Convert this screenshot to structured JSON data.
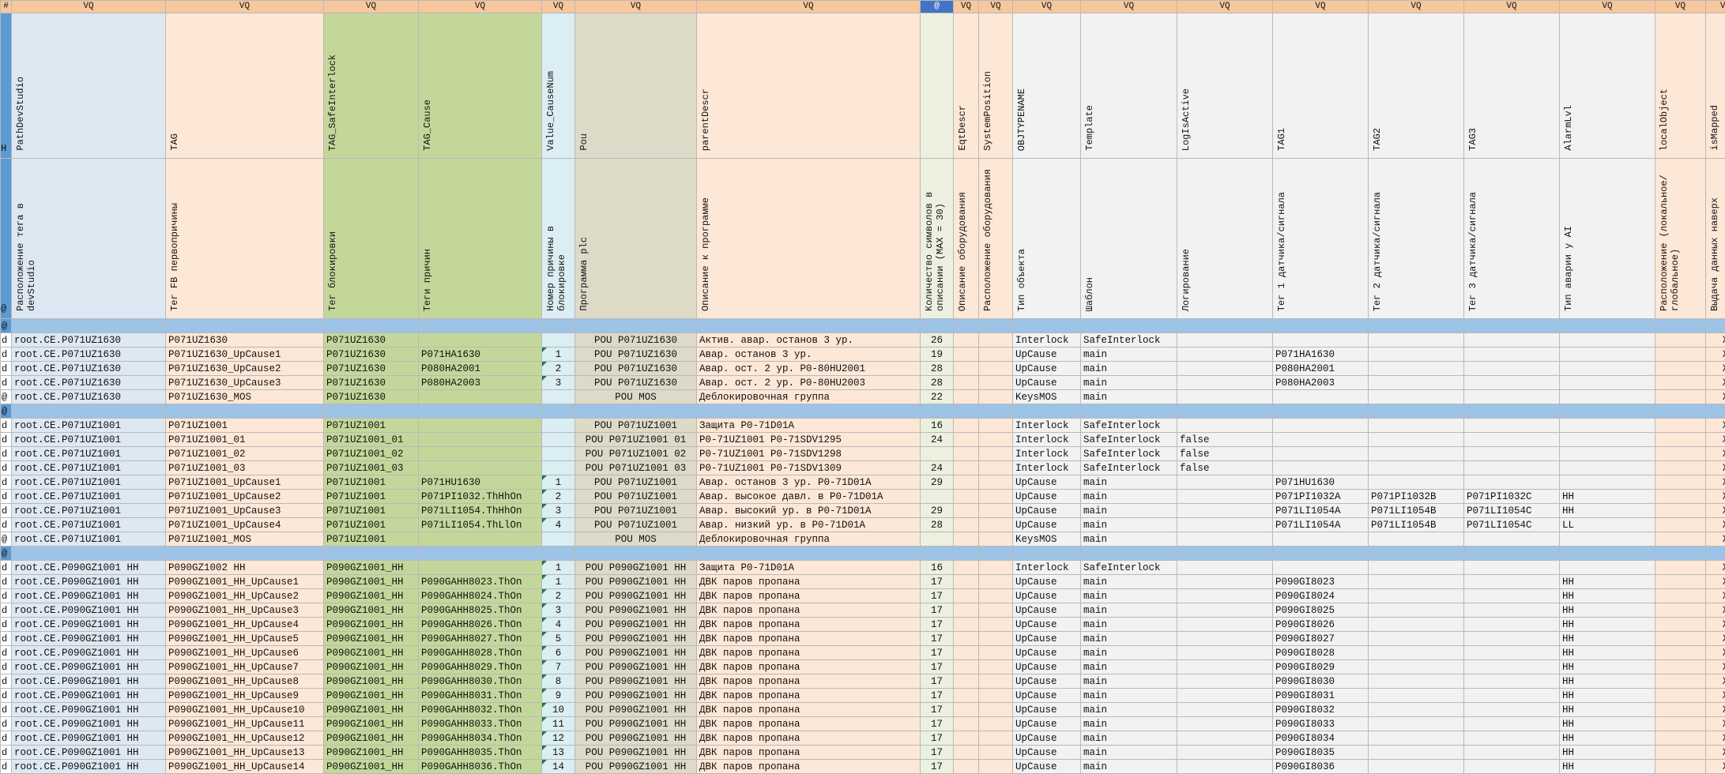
{
  "colors": {
    "vq_header": "#f7c79d",
    "path": "#dde8f2",
    "tag": "#fde7d6",
    "interlock": "#c4d79b",
    "separator": "#9dc3e6",
    "marker": "#5b9bd5"
  },
  "columns": [
    {
      "key": "path",
      "vq": "VQ",
      "name": "PathDevStudio",
      "desc": "Расположение тега в devStudio",
      "cls": "pb",
      "w": 195
    },
    {
      "key": "tag",
      "vq": "VQ",
      "name": "TAG",
      "desc": "Тег FB первопричины",
      "cls": "pe",
      "w": 200
    },
    {
      "key": "tag_safe",
      "vq": "VQ",
      "name": "TAG_SafeInterlock",
      "desc": "Тег блокировки",
      "cls": "gr",
      "w": 120
    },
    {
      "key": "tag_cause",
      "vq": "VQ",
      "name": "TAG_Cause",
      "desc": "Теги причин",
      "cls": "gr",
      "w": 156
    },
    {
      "key": "cause_num",
      "vq": "VQ",
      "name": "Value_CauseNum",
      "desc": "Номер причины в блокировке",
      "cls": "bl",
      "w": 42
    },
    {
      "key": "pou",
      "vq": "VQ",
      "name": "Pou",
      "desc": "Программа plc",
      "cls": "ol",
      "w": 154
    },
    {
      "key": "parent_descr",
      "vq": "VQ",
      "name": "parentDescr",
      "desc": "Описание к программе",
      "cls": "pe",
      "w": 283
    },
    {
      "key": "char_count",
      "vq": "@",
      "name": "",
      "desc": "Количество символов в описании (MAX = 30)",
      "cls": "ng",
      "w": 42
    },
    {
      "key": "eqt_descr",
      "vq": "VQ",
      "name": "EqtDescr",
      "desc": "Описание оборудования",
      "cls": "pe",
      "w": 32
    },
    {
      "key": "sys_pos",
      "vq": "VQ",
      "name": "SystemPosition",
      "desc": "Расположение оборудования",
      "cls": "pe",
      "w": 43
    },
    {
      "key": "objtype",
      "vq": "VQ",
      "name": "OBJTYPENAME",
      "desc": "Тип объекта",
      "cls": "gy",
      "w": 86
    },
    {
      "key": "template",
      "vq": "VQ",
      "name": "Template",
      "desc": "Шаблон",
      "cls": "gy",
      "w": 122
    },
    {
      "key": "log_active",
      "vq": "VQ",
      "name": "LogIsActive",
      "desc": "Логирование",
      "cls": "gy",
      "w": 121
    },
    {
      "key": "tag1",
      "vq": "VQ",
      "name": "TAG1",
      "desc": "Тег 1 датчика/сигнала",
      "cls": "gy",
      "w": 121
    },
    {
      "key": "tag2",
      "vq": "VQ",
      "name": "TAG2",
      "desc": "Тег 2 датчика/сигнала",
      "cls": "gy",
      "w": 121
    },
    {
      "key": "tag3",
      "vq": "VQ",
      "name": "TAG3",
      "desc": "Тег 3 датчика/сигнала",
      "cls": "gy",
      "w": 121
    },
    {
      "key": "alarm",
      "vq": "VQ",
      "name": "AlarmLvl",
      "desc": "Тип аварии у AI",
      "cls": "gy",
      "w": 121
    },
    {
      "key": "local_obj",
      "vq": "VQ",
      "name": "localObject",
      "desc": "Расположение (локальное/глобальное)",
      "cls": "pe",
      "w": 64
    },
    {
      "key": "is_mapped",
      "vq": "VQ",
      "name": "isMapped",
      "desc": "Выдача данных наверх",
      "cls": "pe",
      "w": 50
    }
  ],
  "marker_header": {
    "vq": "#",
    "hdr": "H",
    "desc": "@"
  },
  "rows": [
    {
      "type": "sep",
      "mk": "@"
    },
    {
      "mk": "d",
      "path": "root.CE.P071UZ1630",
      "tag": "P071UZ1630",
      "tag_safe": "P071UZ1630",
      "tag_cause": "",
      "cause_num": "",
      "pou": "POU P071UZ1630",
      "parent_descr": "Актив. авар. останов 3 ур.",
      "char_count": "26",
      "eqt_descr": "",
      "sys_pos": "",
      "objtype": "Interlock",
      "template": "SafeInterlock",
      "log_active": "",
      "tag1": "",
      "tag2": "",
      "tag3": "",
      "alarm": "",
      "local_obj": "",
      "is_mapped": "X"
    },
    {
      "mk": "d",
      "path": "root.CE.P071UZ1630",
      "tag": "P071UZ1630_UpCause1",
      "tag_safe": "P071UZ1630",
      "tag_cause": "P071HA1630",
      "cause_num": "1",
      "pou": "POU P071UZ1630",
      "parent_descr": "Авар. останов 3 ур.",
      "char_count": "19",
      "eqt_descr": "",
      "sys_pos": "",
      "objtype": "UpCause",
      "template": "main",
      "log_active": "",
      "tag1": "P071HA1630",
      "tag2": "",
      "tag3": "",
      "alarm": "",
      "local_obj": "",
      "is_mapped": "X"
    },
    {
      "mk": "d",
      "path": "root.CE.P071UZ1630",
      "tag": "P071UZ1630_UpCause2",
      "tag_safe": "P071UZ1630",
      "tag_cause": "P080HA2001",
      "cause_num": "2",
      "pou": "POU P071UZ1630",
      "parent_descr": "Авар. ост. 2 ур. P0-80HU2001",
      "char_count": "28",
      "eqt_descr": "",
      "sys_pos": "",
      "objtype": "UpCause",
      "template": "main",
      "log_active": "",
      "tag1": "P080HA2001",
      "tag2": "",
      "tag3": "",
      "alarm": "",
      "local_obj": "",
      "is_mapped": "X"
    },
    {
      "mk": "d",
      "path": "root.CE.P071UZ1630",
      "tag": "P071UZ1630_UpCause3",
      "tag_safe": "P071UZ1630",
      "tag_cause": "P080HA2003",
      "cause_num": "3",
      "pou": "POU P071UZ1630",
      "parent_descr": "Авар. ост. 2 ур. P0-80HU2003",
      "char_count": "28",
      "eqt_descr": "",
      "sys_pos": "",
      "objtype": "UpCause",
      "template": "main",
      "log_active": "",
      "tag1": "P080HA2003",
      "tag2": "",
      "tag3": "",
      "alarm": "",
      "local_obj": "",
      "is_mapped": "X"
    },
    {
      "mk": "@",
      "path": "root.CE.P071UZ1630",
      "tag": "P071UZ1630_MOS",
      "tag_safe": "P071UZ1630",
      "tag_cause": "",
      "cause_num": "",
      "pou": "POU MOS",
      "parent_descr": "Деблокировочная группа",
      "char_count": "22",
      "eqt_descr": "",
      "sys_pos": "",
      "objtype": "KeysMOS",
      "template": "main",
      "log_active": "",
      "tag1": "",
      "tag2": "",
      "tag3": "",
      "alarm": "",
      "local_obj": "",
      "is_mapped": "X"
    },
    {
      "type": "sep",
      "mk": "@"
    },
    {
      "mk": "d",
      "path": "root.CE.P071UZ1001",
      "tag": "P071UZ1001",
      "tag_safe": "P071UZ1001",
      "tag_cause": "",
      "cause_num": "",
      "pou": "POU P071UZ1001",
      "parent_descr": "Защита P0-71D01A",
      "char_count": "16",
      "eqt_descr": "",
      "sys_pos": "",
      "objtype": "Interlock",
      "template": "SafeInterlock",
      "log_active": "",
      "tag1": "",
      "tag2": "",
      "tag3": "",
      "alarm": "",
      "local_obj": "",
      "is_mapped": "X"
    },
    {
      "mk": "d",
      "path": "root.CE.P071UZ1001",
      "tag": "P071UZ1001_01",
      "tag_safe": "P071UZ1001_01",
      "tag_cause": "",
      "cause_num": "",
      "pou": "POU P071UZ1001 01",
      "parent_descr": "P0-71UZ1001 P0-71SDV1295",
      "char_count": "24",
      "eqt_descr": "",
      "sys_pos": "",
      "objtype": "Interlock",
      "template": "SafeInterlock",
      "log_active": "false",
      "tag1": "",
      "tag2": "",
      "tag3": "",
      "alarm": "",
      "local_obj": "",
      "is_mapped": "X"
    },
    {
      "mk": "d",
      "path": "root.CE.P071UZ1001",
      "tag": "P071UZ1001_02",
      "tag_safe": "P071UZ1001_02",
      "tag_cause": "",
      "cause_num": "",
      "pou": "POU P071UZ1001 02",
      "parent_descr": "P0-71UZ1001 P0-71SDV1298",
      "char_count": "",
      "eqt_descr": "",
      "sys_pos": "",
      "objtype": "Interlock",
      "template": "SafeInterlock",
      "log_active": "false",
      "tag1": "",
      "tag2": "",
      "tag3": "",
      "alarm": "",
      "local_obj": "",
      "is_mapped": "X"
    },
    {
      "mk": "d",
      "path": "root.CE.P071UZ1001",
      "tag": "P071UZ1001_03",
      "tag_safe": "P071UZ1001_03",
      "tag_cause": "",
      "cause_num": "",
      "pou": "POU P071UZ1001 03",
      "parent_descr": "P0-71UZ1001 P0-71SDV1309",
      "char_count": "24",
      "eqt_descr": "",
      "sys_pos": "",
      "objtype": "Interlock",
      "template": "SafeInterlock",
      "log_active": "false",
      "tag1": "",
      "tag2": "",
      "tag3": "",
      "alarm": "",
      "local_obj": "",
      "is_mapped": "X"
    },
    {
      "mk": "d",
      "path": "root.CE.P071UZ1001",
      "tag": "P071UZ1001_UpCause1",
      "tag_safe": "P071UZ1001",
      "tag_cause": "P071HU1630",
      "cause_num": "1",
      "pou": "POU P071UZ1001",
      "parent_descr": "Авар. останов 3 ур. P0-71D01A",
      "char_count": "29",
      "eqt_descr": "",
      "sys_pos": "",
      "objtype": "UpCause",
      "template": "main",
      "log_active": "",
      "tag1": "P071HU1630",
      "tag2": "",
      "tag3": "",
      "alarm": "",
      "local_obj": "",
      "is_mapped": "X"
    },
    {
      "mk": "d",
      "path": "root.CE.P071UZ1001",
      "tag": "P071UZ1001_UpCause2",
      "tag_safe": "P071UZ1001",
      "tag_cause": "P071PI1032.ThHhOn",
      "cause_num": "2",
      "pou": "POU P071UZ1001",
      "parent_descr": "Авар. высокое давл. в P0-71D01A",
      "char_count": "",
      "eqt_descr": "",
      "sys_pos": "",
      "objtype": "UpCause",
      "template": "main",
      "log_active": "",
      "tag1": "P071PI1032A",
      "tag2": "P071PI1032B",
      "tag3": "P071PI1032C",
      "alarm": "HH",
      "local_obj": "",
      "is_mapped": "X"
    },
    {
      "mk": "d",
      "path": "root.CE.P071UZ1001",
      "tag": "P071UZ1001_UpCause3",
      "tag_safe": "P071UZ1001",
      "tag_cause": "P071LI1054.ThHhOn",
      "cause_num": "3",
      "pou": "POU P071UZ1001",
      "parent_descr": "Авар. высокий ур. в P0-71D01A",
      "char_count": "29",
      "eqt_descr": "",
      "sys_pos": "",
      "objtype": "UpCause",
      "template": "main",
      "log_active": "",
      "tag1": "P071LI1054A",
      "tag2": "P071LI1054B",
      "tag3": "P071LI1054C",
      "alarm": "HH",
      "local_obj": "",
      "is_mapped": "X"
    },
    {
      "mk": "d",
      "path": "root.CE.P071UZ1001",
      "tag": "P071UZ1001_UpCause4",
      "tag_safe": "P071UZ1001",
      "tag_cause": "P071LI1054.ThLlOn",
      "cause_num": "4",
      "pou": "POU P071UZ1001",
      "parent_descr": "Авар. низкий ур. в P0-71D01A",
      "char_count": "28",
      "eqt_descr": "",
      "sys_pos": "",
      "objtype": "UpCause",
      "template": "main",
      "log_active": "",
      "tag1": "P071LI1054A",
      "tag2": "P071LI1054B",
      "tag3": "P071LI1054C",
      "alarm": "LL",
      "local_obj": "",
      "is_mapped": "X"
    },
    {
      "mk": "@",
      "path": "root.CE.P071UZ1001",
      "tag": "P071UZ1001_MOS",
      "tag_safe": "P071UZ1001",
      "tag_cause": "",
      "cause_num": "",
      "pou": "POU MOS",
      "parent_descr": "Деблокировочная группа",
      "char_count": "",
      "eqt_descr": "",
      "sys_pos": "",
      "objtype": "KeysMOS",
      "template": "main",
      "log_active": "",
      "tag1": "",
      "tag2": "",
      "tag3": "",
      "alarm": "",
      "local_obj": "",
      "is_mapped": "X"
    },
    {
      "type": "sep",
      "mk": "@"
    },
    {
      "mk": "d",
      "path": "root.CE.P090GZ1001 HH",
      "tag": "P090GZ1002 HH",
      "tag_safe": "P090GZ1001_HH",
      "tag_cause": "",
      "cause_num": "1",
      "pou": "POU P090GZ1001 HH",
      "parent_descr": "Защита P0-71D01A",
      "char_count": "16",
      "eqt_descr": "",
      "sys_pos": "",
      "objtype": "Interlock",
      "template": "SafeInterlock",
      "log_active": "",
      "tag1": "",
      "tag2": "",
      "tag3": "",
      "alarm": "",
      "local_obj": "",
      "is_mapped": "X"
    },
    {
      "mk": "d",
      "path": "root.CE.P090GZ1001 HH",
      "tag": "P090GZ1001_HH_UpCause1",
      "tag_safe": "P090GZ1001_HH",
      "tag_cause": "P090GAHH8023.ThOn",
      "cause_num": "1",
      "pou": "POU P090GZ1001 HH",
      "parent_descr": "ДВК паров пропана",
      "char_count": "17",
      "eqt_descr": "",
      "sys_pos": "",
      "objtype": "UpCause",
      "template": "main",
      "log_active": "",
      "tag1": "P090GI8023",
      "tag2": "",
      "tag3": "",
      "alarm": "HH",
      "local_obj": "",
      "is_mapped": "X"
    },
    {
      "mk": "d",
      "path": "root.CE.P090GZ1001 HH",
      "tag": "P090GZ1001_HH_UpCause2",
      "tag_safe": "P090GZ1001_HH",
      "tag_cause": "P090GAHH8024.ThOn",
      "cause_num": "2",
      "pou": "POU P090GZ1001 HH",
      "parent_descr": "ДВК паров пропана",
      "char_count": "17",
      "eqt_descr": "",
      "sys_pos": "",
      "objtype": "UpCause",
      "template": "main",
      "log_active": "",
      "tag1": "P090GI8024",
      "tag2": "",
      "tag3": "",
      "alarm": "HH",
      "local_obj": "",
      "is_mapped": "X"
    },
    {
      "mk": "d",
      "path": "root.CE.P090GZ1001 HH",
      "tag": "P090GZ1001_HH_UpCause3",
      "tag_safe": "P090GZ1001_HH",
      "tag_cause": "P090GAHH8025.ThOn",
      "cause_num": "3",
      "pou": "POU P090GZ1001 HH",
      "parent_descr": "ДВК паров пропана",
      "char_count": "17",
      "eqt_descr": "",
      "sys_pos": "",
      "objtype": "UpCause",
      "template": "main",
      "log_active": "",
      "tag1": "P090GI8025",
      "tag2": "",
      "tag3": "",
      "alarm": "HH",
      "local_obj": "",
      "is_mapped": "X"
    },
    {
      "mk": "d",
      "path": "root.CE.P090GZ1001 HH",
      "tag": "P090GZ1001_HH_UpCause4",
      "tag_safe": "P090GZ1001_HH",
      "tag_cause": "P090GAHH8026.ThOn",
      "cause_num": "4",
      "pou": "POU P090GZ1001 HH",
      "parent_descr": "ДВК паров пропана",
      "char_count": "17",
      "eqt_descr": "",
      "sys_pos": "",
      "objtype": "UpCause",
      "template": "main",
      "log_active": "",
      "tag1": "P090GI8026",
      "tag2": "",
      "tag3": "",
      "alarm": "HH",
      "local_obj": "",
      "is_mapped": "X"
    },
    {
      "mk": "d",
      "path": "root.CE.P090GZ1001 HH",
      "tag": "P090GZ1001_HH_UpCause5",
      "tag_safe": "P090GZ1001_HH",
      "tag_cause": "P090GAHH8027.ThOn",
      "cause_num": "5",
      "pou": "POU P090GZ1001 HH",
      "parent_descr": "ДВК паров пропана",
      "char_count": "17",
      "eqt_descr": "",
      "sys_pos": "",
      "objtype": "UpCause",
      "template": "main",
      "log_active": "",
      "tag1": "P090GI8027",
      "tag2": "",
      "tag3": "",
      "alarm": "HH",
      "local_obj": "",
      "is_mapped": "X"
    },
    {
      "mk": "d",
      "path": "root.CE.P090GZ1001 HH",
      "tag": "P090GZ1001_HH_UpCause6",
      "tag_safe": "P090GZ1001_HH",
      "tag_cause": "P090GAHH8028.ThOn",
      "cause_num": "6",
      "pou": "POU P090GZ1001 HH",
      "parent_descr": "ДВК паров пропана",
      "char_count": "17",
      "eqt_descr": "",
      "sys_pos": "",
      "objtype": "UpCause",
      "template": "main",
      "log_active": "",
      "tag1": "P090GI8028",
      "tag2": "",
      "tag3": "",
      "alarm": "HH",
      "local_obj": "",
      "is_mapped": "X"
    },
    {
      "mk": "d",
      "path": "root.CE.P090GZ1001 HH",
      "tag": "P090GZ1001_HH_UpCause7",
      "tag_safe": "P090GZ1001_HH",
      "tag_cause": "P090GAHH8029.ThOn",
      "cause_num": "7",
      "pou": "POU P090GZ1001 HH",
      "parent_descr": "ДВК паров пропана",
      "char_count": "17",
      "eqt_descr": "",
      "sys_pos": "",
      "objtype": "UpCause",
      "template": "main",
      "log_active": "",
      "tag1": "P090GI8029",
      "tag2": "",
      "tag3": "",
      "alarm": "HH",
      "local_obj": "",
      "is_mapped": "X"
    },
    {
      "mk": "d",
      "path": "root.CE.P090GZ1001 HH",
      "tag": "P090GZ1001_HH_UpCause8",
      "tag_safe": "P090GZ1001_HH",
      "tag_cause": "P090GAHH8030.ThOn",
      "cause_num": "8",
      "pou": "POU P090GZ1001 HH",
      "parent_descr": "ДВК паров пропана",
      "char_count": "17",
      "eqt_descr": "",
      "sys_pos": "",
      "objtype": "UpCause",
      "template": "main",
      "log_active": "",
      "tag1": "P090GI8030",
      "tag2": "",
      "tag3": "",
      "alarm": "HH",
      "local_obj": "",
      "is_mapped": "X"
    },
    {
      "mk": "d",
      "path": "root.CE.P090GZ1001 HH",
      "tag": "P090GZ1001_HH_UpCause9",
      "tag_safe": "P090GZ1001_HH",
      "tag_cause": "P090GAHH8031.ThOn",
      "cause_num": "9",
      "pou": "POU P090GZ1001 HH",
      "parent_descr": "ДВК паров пропана",
      "char_count": "17",
      "eqt_descr": "",
      "sys_pos": "",
      "objtype": "UpCause",
      "template": "main",
      "log_active": "",
      "tag1": "P090GI8031",
      "tag2": "",
      "tag3": "",
      "alarm": "HH",
      "local_obj": "",
      "is_mapped": "X"
    },
    {
      "mk": "d",
      "path": "root.CE.P090GZ1001 HH",
      "tag": "P090GZ1001_HH_UpCause10",
      "tag_safe": "P090GZ1001_HH",
      "tag_cause": "P090GAHH8032.ThOn",
      "cause_num": "10",
      "pou": "POU P090GZ1001 HH",
      "parent_descr": "ДВК паров пропана",
      "char_count": "17",
      "eqt_descr": "",
      "sys_pos": "",
      "objtype": "UpCause",
      "template": "main",
      "log_active": "",
      "tag1": "P090GI8032",
      "tag2": "",
      "tag3": "",
      "alarm": "HH",
      "local_obj": "",
      "is_mapped": "X"
    },
    {
      "mk": "d",
      "path": "root.CE.P090GZ1001 HH",
      "tag": "P090GZ1001_HH_UpCause11",
      "tag_safe": "P090GZ1001_HH",
      "tag_cause": "P090GAHH8033.ThOn",
      "cause_num": "11",
      "pou": "POU P090GZ1001 HH",
      "parent_descr": "ДВК паров пропана",
      "char_count": "17",
      "eqt_descr": "",
      "sys_pos": "",
      "objtype": "UpCause",
      "template": "main",
      "log_active": "",
      "tag1": "P090GI8033",
      "tag2": "",
      "tag3": "",
      "alarm": "HH",
      "local_obj": "",
      "is_mapped": "X"
    },
    {
      "mk": "d",
      "path": "root.CE.P090GZ1001 HH",
      "tag": "P090GZ1001_HH_UpCause12",
      "tag_safe": "P090GZ1001_HH",
      "tag_cause": "P090GAHH8034.ThOn",
      "cause_num": "12",
      "pou": "POU P090GZ1001 HH",
      "parent_descr": "ДВК паров пропана",
      "char_count": "17",
      "eqt_descr": "",
      "sys_pos": "",
      "objtype": "UpCause",
      "template": "main",
      "log_active": "",
      "tag1": "P090GI8034",
      "tag2": "",
      "tag3": "",
      "alarm": "HH",
      "local_obj": "",
      "is_mapped": "X"
    },
    {
      "mk": "d",
      "path": "root.CE.P090GZ1001 HH",
      "tag": "P090GZ1001_HH_UpCause13",
      "tag_safe": "P090GZ1001_HH",
      "tag_cause": "P090GAHH8035.ThOn",
      "cause_num": "13",
      "pou": "POU P090GZ1001 HH",
      "parent_descr": "ДВК паров пропана",
      "char_count": "17",
      "eqt_descr": "",
      "sys_pos": "",
      "objtype": "UpCause",
      "template": "main",
      "log_active": "",
      "tag1": "P090GI8035",
      "tag2": "",
      "tag3": "",
      "alarm": "HH",
      "local_obj": "",
      "is_mapped": "X"
    },
    {
      "mk": "d",
      "path": "root.CE.P090GZ1001 HH",
      "tag": "P090GZ1001_HH_UpCause14",
      "tag_safe": "P090GZ1001_HH",
      "tag_cause": "P090GAHH8036.ThOn",
      "cause_num": "14",
      "pou": "POU P090GZ1001 HH",
      "parent_descr": "ДВК паров пропана",
      "char_count": "17",
      "eqt_descr": "",
      "sys_pos": "",
      "objtype": "UpCause",
      "template": "main",
      "log_active": "",
      "tag1": "P090GI8036",
      "tag2": "",
      "tag3": "",
      "alarm": "HH",
      "local_obj": "",
      "is_mapped": "X"
    }
  ]
}
